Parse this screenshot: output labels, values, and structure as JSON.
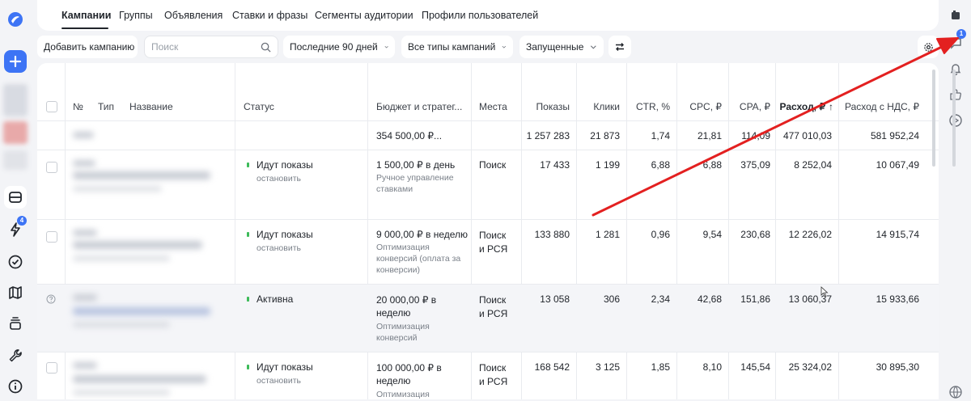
{
  "left_rail": {
    "notification_count": "4",
    "accent_color": "#3d74f5"
  },
  "right_rail": {
    "notification_count": "1"
  },
  "tabs": [
    {
      "label": "Кампании",
      "active": true
    },
    {
      "label": "Группы"
    },
    {
      "label": "Объявления"
    },
    {
      "label": "Ставки и фразы"
    },
    {
      "label": "Сегменты аудитории"
    },
    {
      "label": "Профили пользователей"
    }
  ],
  "toolbar": {
    "add_campaign": "Добавить кампанию",
    "search_placeholder": "Поиск",
    "period": "Последние 90 дней",
    "campaign_types": "Все типы кампаний",
    "state": "Запущенные"
  },
  "table": {
    "headers": {
      "num": "№",
      "type": "Тип",
      "name": "Название",
      "status": "Статус",
      "budget": "Бюджет и стратег...",
      "places": "Места",
      "impressions": "Показы",
      "clicks": "Клики",
      "ctr": "CTR, %",
      "cpc": "CPC, ₽",
      "cpa": "CPA, ₽",
      "spend": "Расход, ₽",
      "spend_vat": "Расход с НДС, ₽"
    },
    "totals": {
      "budget": "354 500,00 ₽...",
      "impressions": "1 257 283",
      "clicks": "21 873",
      "ctr": "1,74",
      "cpc": "21,81",
      "cpa": "114,09",
      "spend": "477 010,03",
      "spend_vat": "581 952,24"
    },
    "rows": [
      {
        "status": "Идут показы",
        "status_action": "остановить",
        "budget": "1 500,00 ₽ в день",
        "budget_sub": "Ручное управление ставками",
        "places": "Поиск",
        "impressions": "17 433",
        "clicks": "1 199",
        "ctr": "6,88",
        "cpc": "6,88",
        "cpa": "375,09",
        "spend": "8 252,04",
        "spend_vat": "10 067,49"
      },
      {
        "status": "Идут показы",
        "status_action": "остановить",
        "budget": "9 000,00 ₽ в неделю",
        "budget_sub": "Оптимизация конверсий (оплата за конверсии)",
        "places": "Поиск и РСЯ",
        "impressions": "133 880",
        "clicks": "1 281",
        "ctr": "0,96",
        "cpc": "9,54",
        "cpa": "230,68",
        "spend": "12 226,02",
        "spend_vat": "14 915,74"
      },
      {
        "status": "Активна",
        "status_action": "",
        "budget": "20 000,00 ₽ в неделю",
        "budget_sub": "Оптимизация конверсий",
        "places": "Поиск и РСЯ",
        "impressions": "13 058",
        "clicks": "306",
        "ctr": "2,34",
        "cpc": "42,68",
        "cpa": "151,86",
        "spend": "13 060,37",
        "spend_vat": "15 933,66"
      },
      {
        "status": "Идут показы",
        "status_action": "остановить",
        "budget": "100 000,00 ₽ в неделю",
        "budget_sub": "Оптимизация",
        "places": "Поиск и РСЯ",
        "impressions": "168 542",
        "clicks": "3 125",
        "ctr": "1,85",
        "cpc": "8,10",
        "cpa": "145,54",
        "spend": "25 324,02",
        "spend_vat": "30 895,30"
      }
    ]
  },
  "annotation_color": "#e32020"
}
